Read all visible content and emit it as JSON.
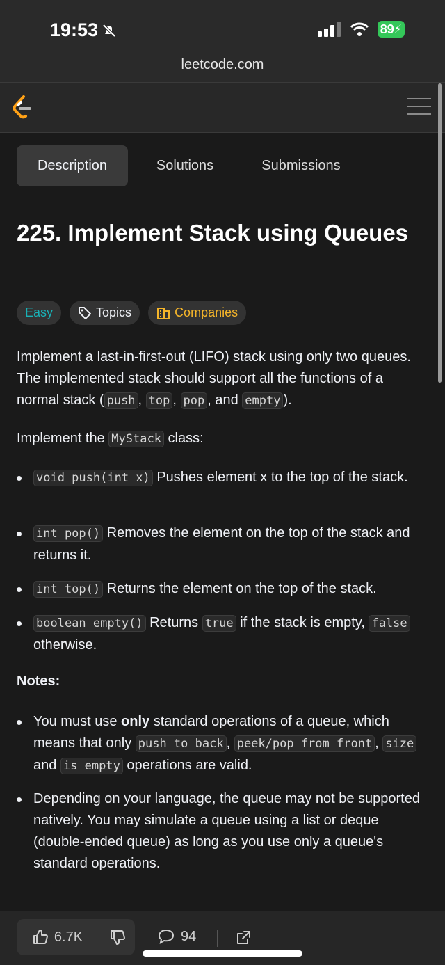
{
  "statusbar": {
    "time": "19:53",
    "battery": "89"
  },
  "browser": {
    "url": "leetcode.com"
  },
  "tabs": [
    {
      "label": "Description"
    },
    {
      "label": "Solutions"
    },
    {
      "label": "Submissions"
    }
  ],
  "problem": {
    "title": "225. Implement Stack using Queues",
    "badges": {
      "difficulty": "Easy",
      "topics": "Topics",
      "companies": "Companies"
    },
    "intro": {
      "t1": "Implement a last-in-first-out (LIFO) stack using only two queues. The implemented stack should support all the functions of a normal stack (",
      "c1": "push",
      "s1": ", ",
      "c2": "top",
      "s2": ", ",
      "c3": "pop",
      "s3": ", and ",
      "c4": "empty",
      "t2": ")."
    },
    "implement": {
      "t1": "Implement the ",
      "code": "MyStack",
      "t2": " class:"
    },
    "methods": [
      {
        "code": "void push(int x)",
        "text": " Pushes element x to the top of the stack."
      },
      {
        "code": "int pop()",
        "text": " Removes the element on the top of the stack and returns it."
      },
      {
        "code": "int top()",
        "text": " Returns the element on the top of the stack."
      },
      {
        "code": "boolean empty()",
        "text1": " Returns ",
        "code2": "true",
        "text2": " if the stack is empty, ",
        "code3": "false",
        "text3": " otherwise."
      }
    ],
    "notes_heading": "Notes:",
    "notes": [
      {
        "t1": "You must use ",
        "bold": "only",
        "t2": " standard operations of a queue, which means that only ",
        "c1": "push to back",
        "s1": ", ",
        "c2": "peek/pop from front",
        "s2": ", ",
        "c3": "size",
        "s3": " and ",
        "c4": "is empty",
        "t3": " operations are valid."
      },
      {
        "text": "Depending on your language, the queue may not be supported natively. You may simulate a queue using a list or deque (double-ended queue) as long as you use only a queue's standard operations."
      }
    ]
  },
  "bottombar": {
    "likes": "6.7K",
    "comments": "94"
  }
}
